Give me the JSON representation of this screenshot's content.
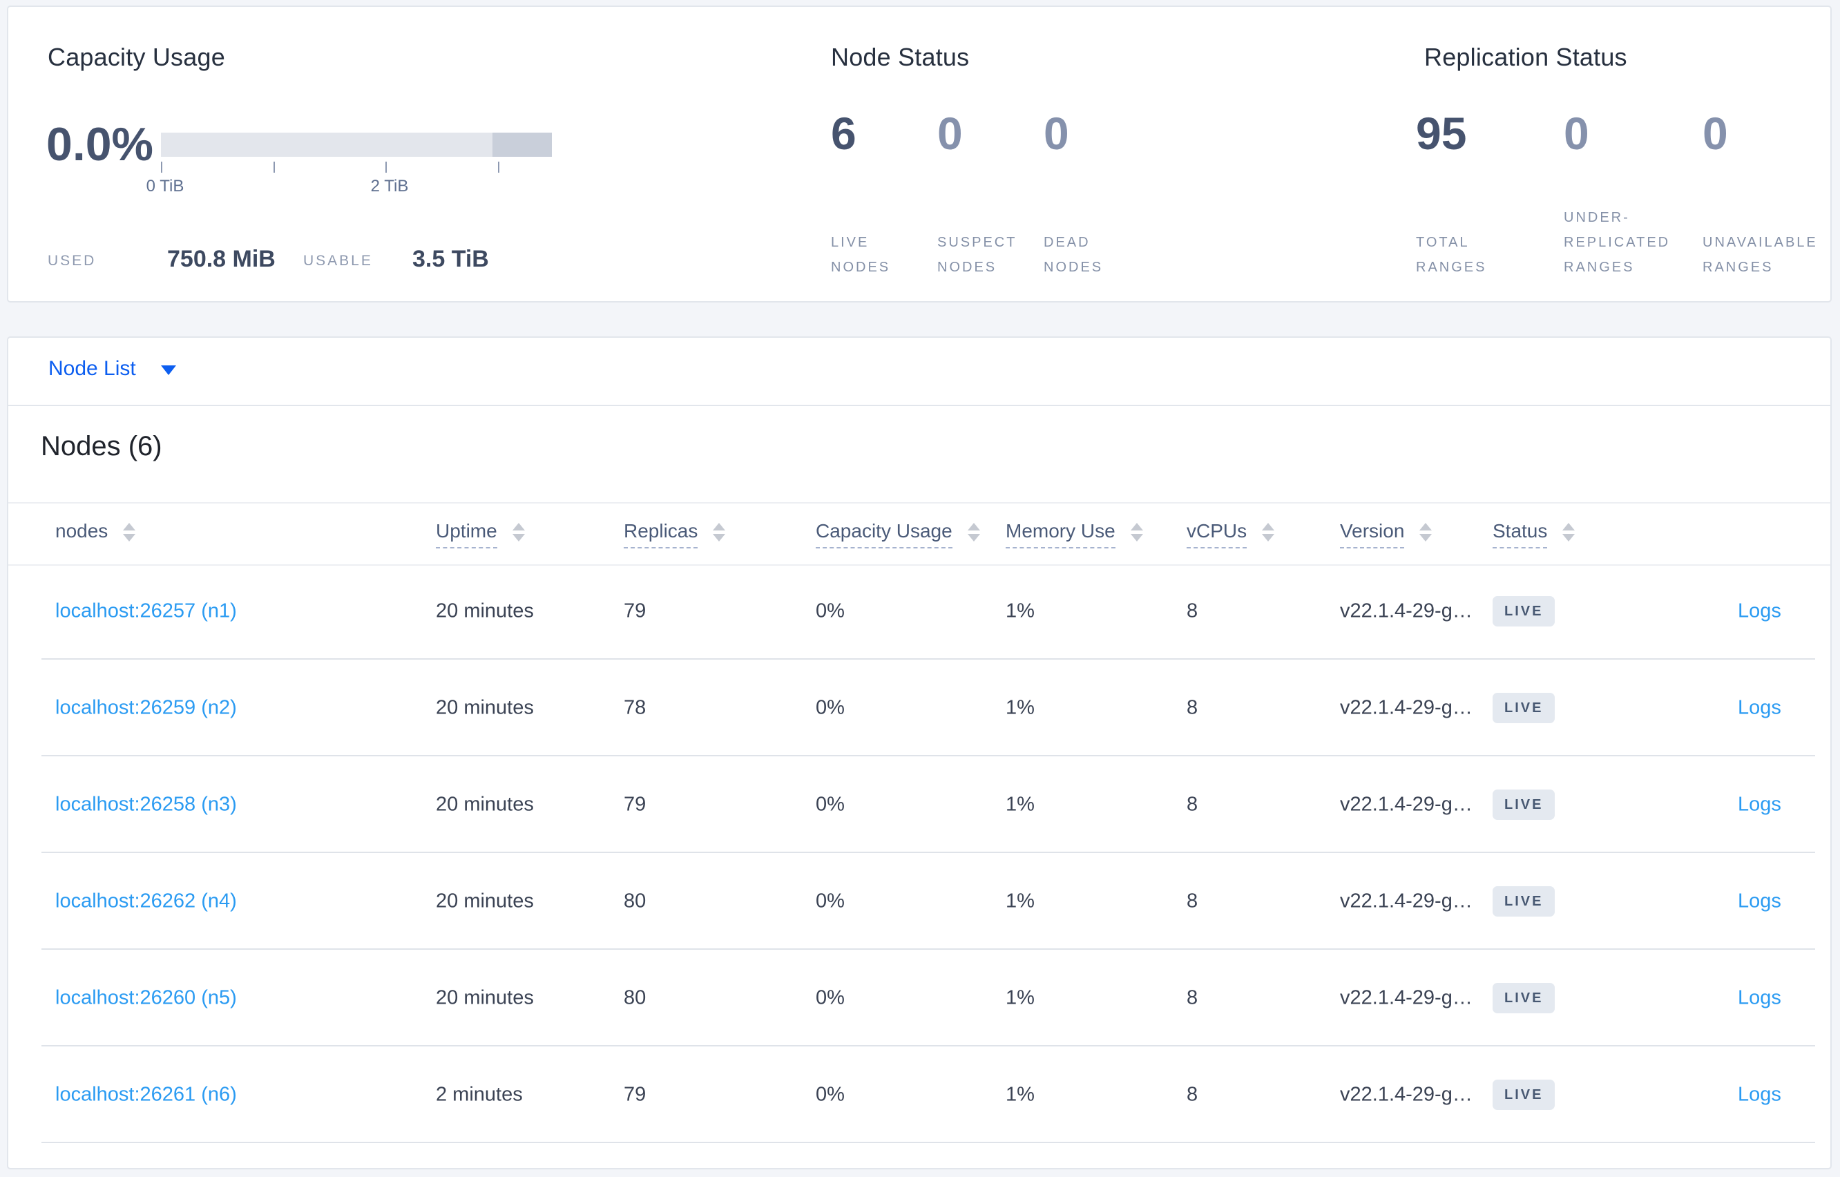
{
  "overview": {
    "capacity": {
      "title": "Capacity Usage",
      "percent": "0.0%",
      "tick_labels": [
        "0 TiB",
        "2 TiB"
      ],
      "used_label": "USED",
      "used_value": "750.8 MiB",
      "usable_label": "USABLE",
      "usable_value": "3.5 TiB"
    },
    "node_status": {
      "title": "Node Status",
      "stats": [
        {
          "value": "6",
          "label": "LIVE\nNODES"
        },
        {
          "value": "0",
          "label": "SUSPECT\nNODES"
        },
        {
          "value": "0",
          "label": "DEAD\nNODES"
        }
      ]
    },
    "replication": {
      "title": "Replication Status",
      "stats": [
        {
          "value": "95",
          "label": "TOTAL\nRANGES"
        },
        {
          "value": "0",
          "label": "UNDER-\nREPLICATED\nRANGES"
        },
        {
          "value": "0",
          "label": "UNAVAILABLE\nRANGES"
        }
      ]
    }
  },
  "node_list": {
    "dropdown_label": "Node List",
    "section_title": "Nodes (6)",
    "columns": {
      "nodes": "nodes",
      "uptime": "Uptime",
      "replicas": "Replicas",
      "capacity": "Capacity Usage",
      "memory": "Memory Use",
      "vcpus": "vCPUs",
      "version": "Version",
      "status": "Status"
    },
    "rows": [
      {
        "node": "localhost:26257 (n1)",
        "uptime": "20 minutes",
        "replicas": "79",
        "capacity": "0%",
        "memory": "1%",
        "vcpus": "8",
        "version": "v22.1.4-29-g…",
        "status": "LIVE",
        "logs": "Logs"
      },
      {
        "node": "localhost:26259 (n2)",
        "uptime": "20 minutes",
        "replicas": "78",
        "capacity": "0%",
        "memory": "1%",
        "vcpus": "8",
        "version": "v22.1.4-29-g…",
        "status": "LIVE",
        "logs": "Logs"
      },
      {
        "node": "localhost:26258 (n3)",
        "uptime": "20 minutes",
        "replicas": "79",
        "capacity": "0%",
        "memory": "1%",
        "vcpus": "8",
        "version": "v22.1.4-29-g…",
        "status": "LIVE",
        "logs": "Logs"
      },
      {
        "node": "localhost:26262 (n4)",
        "uptime": "20 minutes",
        "replicas": "80",
        "capacity": "0%",
        "memory": "1%",
        "vcpus": "8",
        "version": "v22.1.4-29-g…",
        "status": "LIVE",
        "logs": "Logs"
      },
      {
        "node": "localhost:26260 (n5)",
        "uptime": "20 minutes",
        "replicas": "80",
        "capacity": "0%",
        "memory": "1%",
        "vcpus": "8",
        "version": "v22.1.4-29-g…",
        "status": "LIVE",
        "logs": "Logs"
      },
      {
        "node": "localhost:26261 (n6)",
        "uptime": "2 minutes",
        "replicas": "79",
        "capacity": "0%",
        "memory": "1%",
        "vcpus": "8",
        "version": "v22.1.4-29-g…",
        "status": "LIVE",
        "logs": "Logs"
      }
    ]
  },
  "colors": {
    "accent_blue": "#0c5ef0",
    "link_blue": "#2b9bf2",
    "stat_dark": "#46536e",
    "stat_dim": "#8591ac",
    "badge_bg": "#e4e9f0",
    "badge_text": "#475872",
    "bar_light": "#e3e6ec",
    "bar_dark": "#c9cfda",
    "page_bg": "#f3f5f9"
  }
}
